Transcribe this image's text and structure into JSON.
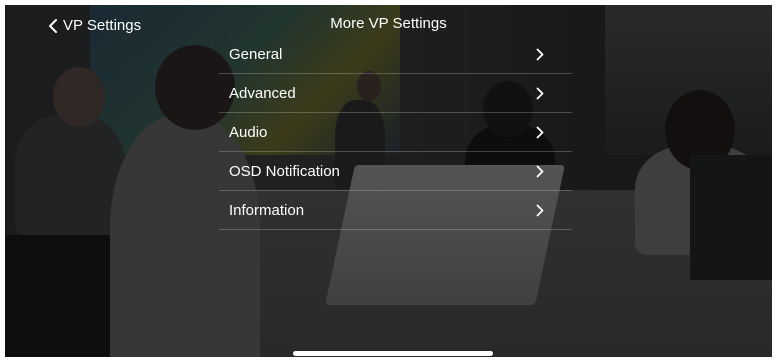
{
  "header": {
    "back_label": "VP Settings",
    "title": "More VP Settings"
  },
  "menu": {
    "items": [
      {
        "label": "General",
        "icon": "chevron-right-icon"
      },
      {
        "label": "Advanced",
        "icon": "chevron-right-icon"
      },
      {
        "label": "Audio",
        "icon": "chevron-right-icon"
      },
      {
        "label": "OSD Notification",
        "icon": "chevron-right-icon"
      },
      {
        "label": "Information",
        "icon": "chevron-right-icon"
      }
    ]
  },
  "colors": {
    "text": "#ffffff",
    "divider": "rgba(255,255,255,0.22)",
    "overlay": "rgba(0,0,0,0.55)"
  }
}
